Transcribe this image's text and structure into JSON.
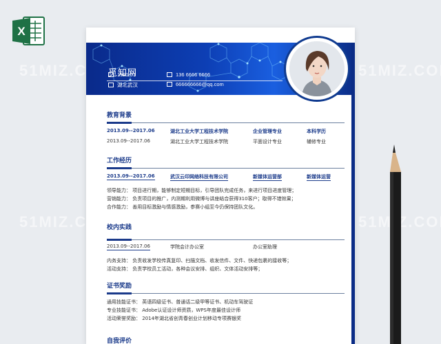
{
  "watermark": "51MIZ.COM",
  "resume": {
    "name": "觅知网",
    "birth": "1991.07",
    "phone": "136 6666 6666",
    "location": "湖北武汉",
    "email": "666666666@qq.com"
  },
  "education": {
    "title": "教育背景",
    "rows": [
      {
        "period": "2013.09--2017.06",
        "school": "湖北工业大学工程技术学院",
        "major": "企业管理专业",
        "degree": "本科学历"
      },
      {
        "period": "2013.09--2017.06",
        "school": "湖北工业大学工程技术学院",
        "major": "平面设计专业",
        "degree": "辅修专业"
      }
    ]
  },
  "work": {
    "title": "工作经历",
    "period": "2013.09--2017.06",
    "company": "武汉云印网络科技有限公司",
    "dept": "新媒体运营部",
    "position": "新媒体运营",
    "lines": [
      "领导能力： 项目进行期，能够制定短期目标，引导团队完成任务，来进行项目进度管理；",
      "营销能力： 负责项目的推广，内测期利用微博与讲座结合获得310客户；取得不错效果；",
      "合作能力： 善用目标激励与情感激励，参赛小组至今仍保持团队文化。"
    ]
  },
  "campus": {
    "title": "校内实践",
    "period": "2013.09--2017.06",
    "org": "学院会计办公室",
    "role": "办公室助理",
    "lines": [
      "内务支持： 负责收发学校传真复印、扫描文档、收发信件、文件、快递包裹的接收等；",
      "活动支持： 负责学校员工活动，各种会议安排、组织、文体活动安排等；"
    ]
  },
  "awards": {
    "title": "证书奖励",
    "lines": [
      "通用技能证书： 英语四级证书、普通话二级甲等证书、机动车驾驶证",
      "专业技能证书： Adobe认证设计师资质，WPS年度最佳设计师",
      "活动荣誉奖励： 2014年湖北省创青春创业计划移动专项赛银奖"
    ]
  },
  "self": {
    "title": "自我评价"
  },
  "colors": {
    "primary": "#1a3a8a",
    "banner": "#0d3fb5",
    "excel": "#1e7145"
  }
}
